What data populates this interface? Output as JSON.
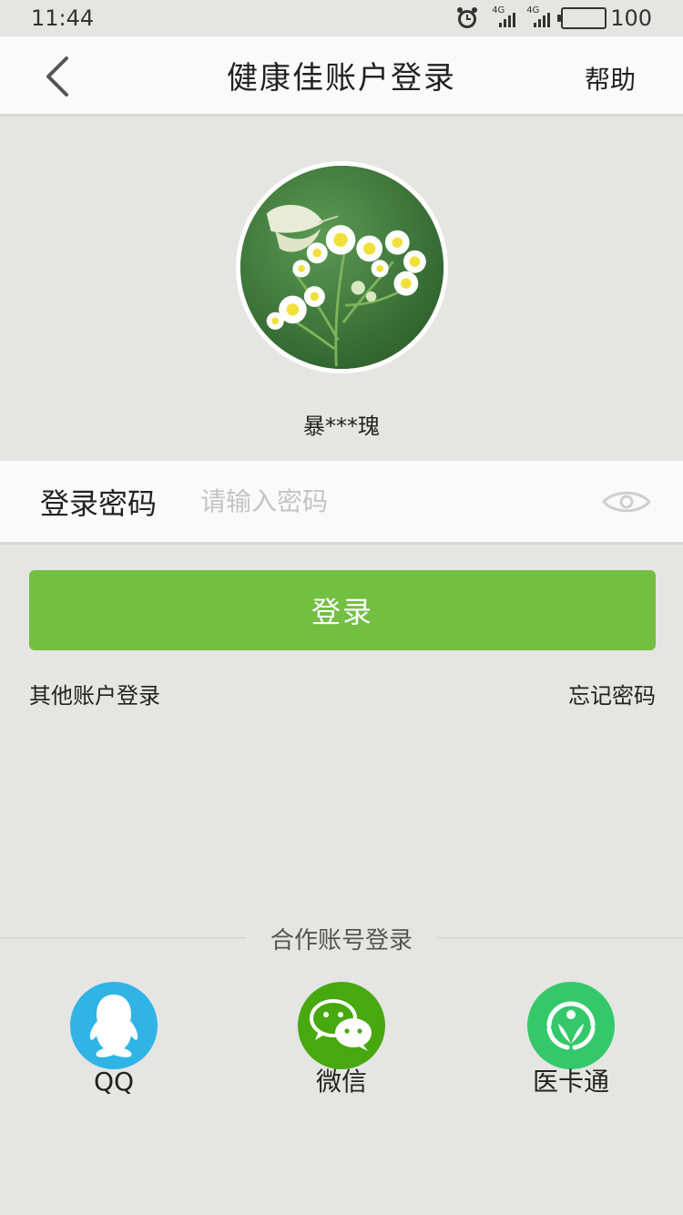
{
  "status_bar": {
    "time": "11:44",
    "network_1": "4G",
    "network_2": "4G",
    "battery": "100"
  },
  "nav": {
    "title": "健康佳账户登录",
    "help": "帮助"
  },
  "user": {
    "masked_name": "暴***瑰"
  },
  "password": {
    "label": "登录密码",
    "placeholder": "请输入密码",
    "value": ""
  },
  "login_button": "登录",
  "links": {
    "other_account": "其他账户登录",
    "forgot_password": "忘记密码"
  },
  "partner": {
    "title": "合作账号登录",
    "items": [
      {
        "label": "QQ",
        "color": "#30b4e6",
        "icon": "qq-penguin-icon"
      },
      {
        "label": "微信",
        "color": "#47a80f",
        "icon": "wechat-icon"
      },
      {
        "label": "医卡通",
        "color": "#34c86a",
        "icon": "yikatong-icon"
      }
    ]
  },
  "colors": {
    "accent": "#72bf42",
    "background": "#e5e5e3",
    "panel": "#fafafa"
  }
}
